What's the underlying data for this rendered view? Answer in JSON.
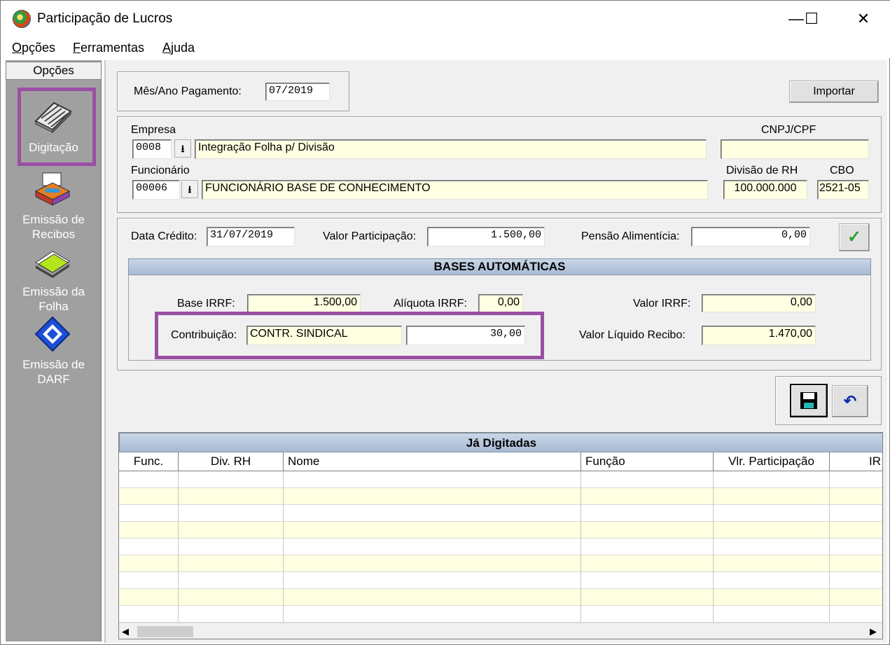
{
  "window": {
    "title": "Participação de Lucros",
    "controls": [
      "—",
      "☐",
      "✕"
    ]
  },
  "menu": [
    "Opções",
    "Ferramentas",
    "Ajuda"
  ],
  "sidebar": {
    "header": "Opções",
    "items": [
      {
        "label1": "Digitação",
        "label2": "",
        "icon": "keyboard-icon",
        "selected": true
      },
      {
        "label1": "Emissão de",
        "label2": "Recibos",
        "icon": "printer-icon"
      },
      {
        "label1": "Emissão da",
        "label2": "Folha",
        "icon": "papers-icon"
      },
      {
        "label1": "Emissão de",
        "label2": "DARF",
        "icon": "darf-icon"
      }
    ]
  },
  "top": {
    "mes_ano_label": "Mês/Ano Pagamento:",
    "mes_ano_value": "07/2019",
    "importar": "Importar"
  },
  "empresa": {
    "label": "Empresa",
    "code": "0008",
    "name": "Integração Folha p/ Divisão",
    "cnpj_label": "CNPJ/CPF",
    "cnpj_value": ""
  },
  "funcionario": {
    "label": "Funcionário",
    "code": "00006",
    "name": "FUNCIONÁRIO BASE DE CONHECIMENTO",
    "divisao_label": "Divisão de RH",
    "divisao_value": "100.000.000",
    "cbo_label": "CBO",
    "cbo_value": "2521-05"
  },
  "valores": {
    "data_credito_label": "Data Crédito:",
    "data_credito": "31/07/2019",
    "valor_part_label": "Valor Participação:",
    "valor_part": "1.500,00",
    "pensao_label": "Pensão Alimentícia:",
    "pensao": "0,00"
  },
  "bases": {
    "title": "BASES AUTOMÁTICAS",
    "base_irrf_label": "Base IRRF:",
    "base_irrf": "1.500,00",
    "aliquota_label": "Alíquota IRRF:",
    "aliquota": "0,00",
    "valor_irrf_label": "Valor IRRF:",
    "valor_irrf": "0,00",
    "contrib_label": "Contribuição:",
    "contrib_name": "CONTR. SINDICAL",
    "contrib_value": "30,00",
    "liquido_label": "Valor Líquido Recibo:",
    "liquido": "1.470,00"
  },
  "grid": {
    "title": "Já Digitadas",
    "columns": [
      "Func.",
      "Div. RH",
      "Nome",
      "Função",
      "Vlr. Participação",
      "IR"
    ],
    "rows": 9
  },
  "colors": {
    "highlight": "#9b4fa3",
    "yellow_field": "#ffffe1",
    "sidebar": "#a0a0a0"
  }
}
